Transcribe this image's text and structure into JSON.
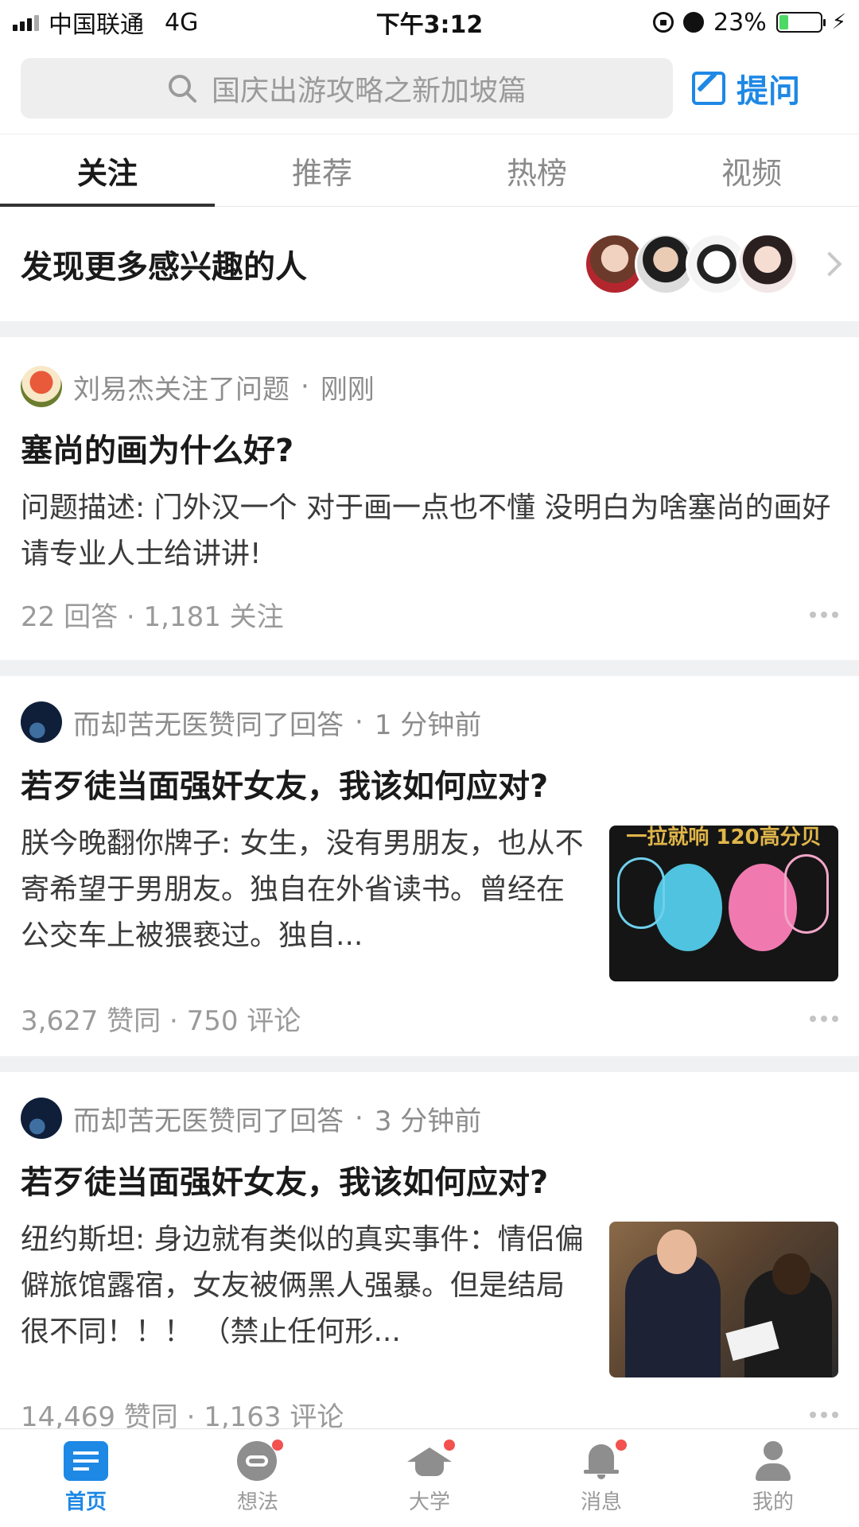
{
  "status": {
    "carrier": "中国联通",
    "network": "4G",
    "time": "下午3:12",
    "battery": "23%",
    "battery_color": "#4cd964"
  },
  "search": {
    "placeholder": "国庆出游攻略之新加坡篇",
    "ask_label": "提问",
    "accent": "#1e88e5"
  },
  "tabs": [
    {
      "label": "关注",
      "active": true
    },
    {
      "label": "推荐"
    },
    {
      "label": "热榜"
    },
    {
      "label": "视频"
    }
  ],
  "discover": {
    "title": "发现更多感兴趣的人"
  },
  "feed": [
    {
      "actor": "刘易杰关注了问题",
      "time": "刚刚",
      "title": "塞尚的画为什么好?",
      "excerpt": "问题描述: 门外汉一个 对于画一点也不懂 没明白为啥塞尚的画好 请专业人士给讲讲!",
      "stat1": "22 回答",
      "stat2": "1,181 关注"
    },
    {
      "actor": "而却苦无医赞同了回答",
      "time": "1 分钟前",
      "title": "若歹徒当面强奸女友，我该如何应对?",
      "excerpt": "朕今晚翻你牌子: 女生，没有男朋友，也从不寄希望于男朋友。独自在外省读书。曾经在公交车上被猥亵过。独自...",
      "thumb_text": "一拉就响 120高分贝",
      "stat1": "3,627 赞同",
      "stat2": "750 评论"
    },
    {
      "actor": "而却苦无医赞同了回答",
      "time": "3 分钟前",
      "title": "若歹徒当面强奸女友，我该如何应对?",
      "excerpt": "纽约斯坦: 身边就有类似的真实事件：情侣偏僻旅馆露宿，女友被俩黑人强暴。但是结局很不同！！！ （禁止任何形...",
      "stat1": "14,469 赞同",
      "stat2": "1,163 评论"
    }
  ],
  "nav": [
    {
      "label": "首页",
      "icon": "home-icon"
    },
    {
      "label": "想法",
      "icon": "ideas-icon"
    },
    {
      "label": "大学",
      "icon": "university-icon"
    },
    {
      "label": "消息",
      "icon": "bell-icon"
    },
    {
      "label": "我的",
      "icon": "profile-icon"
    }
  ],
  "separator": " · "
}
